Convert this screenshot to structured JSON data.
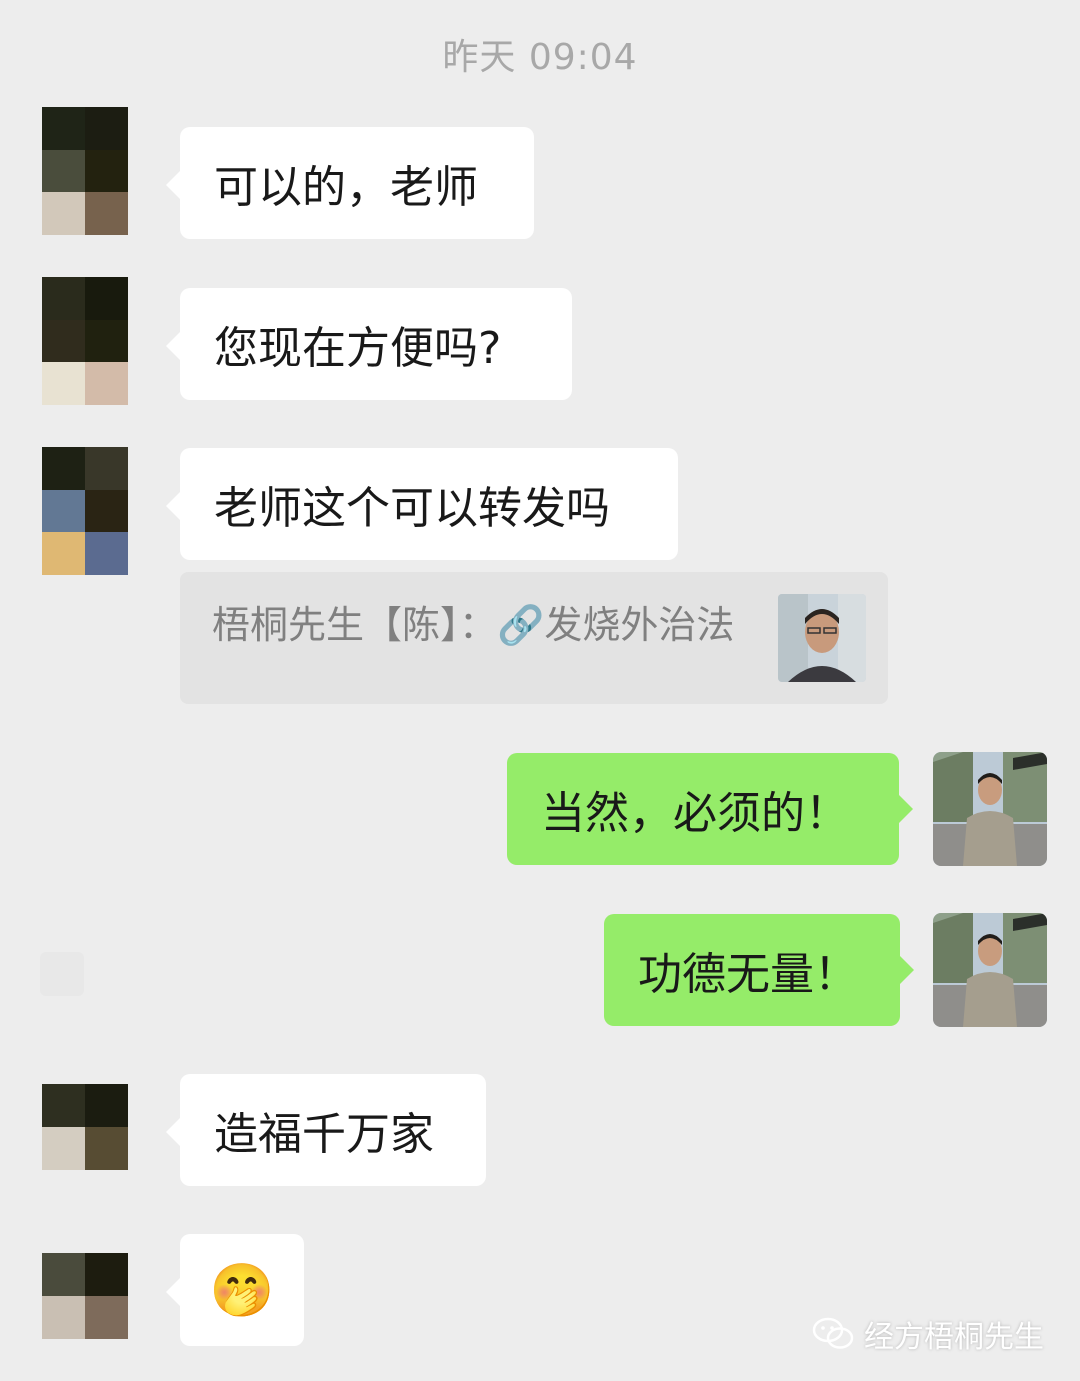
{
  "timestamp": "昨天 09:04",
  "messages": {
    "m1": {
      "sender": "other",
      "text": "可以的，老师"
    },
    "m2": {
      "sender": "other",
      "text": "您现在方便吗?"
    },
    "m3": {
      "sender": "other",
      "text": "老师这个可以转发吗"
    },
    "m3_quote": {
      "text": "梧桐先生【陈】：🔗发烧外治法"
    },
    "m4": {
      "sender": "self",
      "text": "当然，必须的！"
    },
    "m5": {
      "sender": "self",
      "text": "功德无量！"
    },
    "m6": {
      "sender": "other",
      "text": "造福千万家"
    },
    "m7": {
      "sender": "other",
      "text": "🤭"
    }
  },
  "watermark": {
    "label": "经方梧桐先生",
    "icon": "wechat-official-account-icon"
  },
  "colors": {
    "background": "#ededed",
    "bubble_other": "#ffffff",
    "bubble_self": "#95ec69",
    "quote_bg": "#e3e3e3",
    "timestamp": "#a8a8a8"
  }
}
